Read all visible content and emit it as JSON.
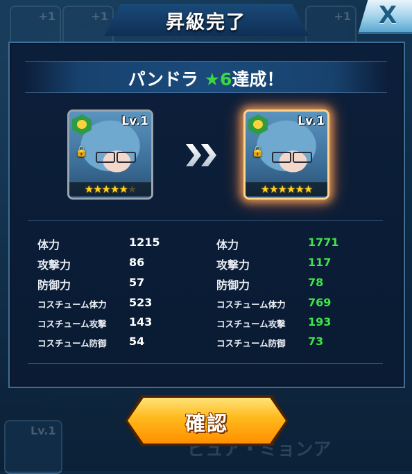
{
  "window": {
    "title": "昇級完了",
    "close_label": "X"
  },
  "achievement": {
    "character": "パンドラ ",
    "star": "★",
    "rank": "6",
    "suffix": "達成！"
  },
  "before_card": {
    "level": "Lv.1",
    "stars": {
      "filled": 5,
      "total": 6
    }
  },
  "after_card": {
    "level": "Lv.1",
    "stars": {
      "filled": 6,
      "total": 6
    }
  },
  "stats": {
    "before": [
      {
        "label": "体力",
        "value": "1215"
      },
      {
        "label": "攻撃力",
        "value": "86"
      },
      {
        "label": "防御力",
        "value": "57"
      },
      {
        "label": "コスチューム体力",
        "value": "523"
      },
      {
        "label": "コスチューム攻撃",
        "value": "143"
      },
      {
        "label": "コスチューム防御",
        "value": "54"
      }
    ],
    "after": [
      {
        "label": "体力",
        "value": "1771"
      },
      {
        "label": "攻撃力",
        "value": "117"
      },
      {
        "label": "防御力",
        "value": "78"
      },
      {
        "label": "コスチューム体力",
        "value": "769"
      },
      {
        "label": "コスチューム攻撃",
        "value": "193"
      },
      {
        "label": "コスチューム防御",
        "value": "73"
      }
    ]
  },
  "buttons": {
    "confirm_label": "確認"
  },
  "colors": {
    "increase": "#3fe54a",
    "accent_button": "#ffb81a",
    "panel": "#0c1f3a"
  },
  "icons": [
    "close-icon",
    "element-hex-icon",
    "lock-icon",
    "double-chevron-right-icon",
    "star-icon"
  ]
}
